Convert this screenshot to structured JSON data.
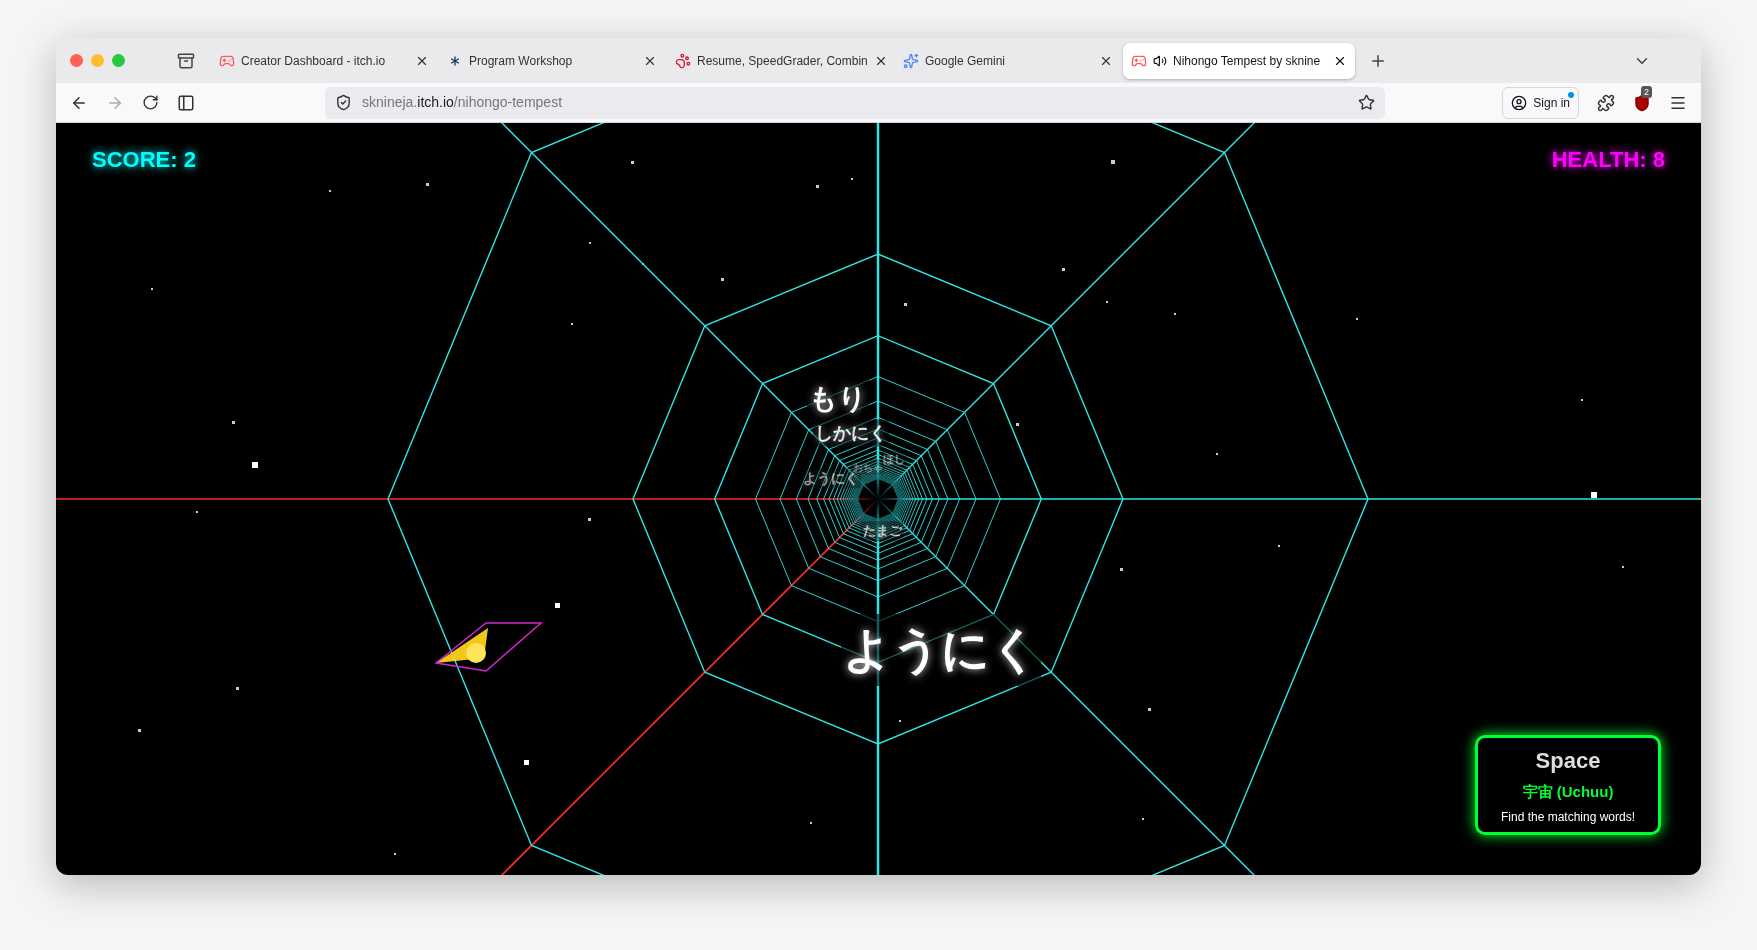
{
  "browser": {
    "tabs": [
      {
        "title": "Creator Dashboard - itch.io",
        "kind": "itch",
        "selected": false,
        "audio": false
      },
      {
        "title": "Program Workshop",
        "kind": "asterisk",
        "selected": false,
        "audio": false
      },
      {
        "title": "Resume, SpeedGrader, Combin",
        "kind": "paw",
        "selected": false,
        "audio": false
      },
      {
        "title": "Google Gemini",
        "kind": "gemini",
        "selected": false,
        "audio": false
      },
      {
        "title": "Nihongo Tempest by sknine",
        "kind": "itch",
        "selected": true,
        "audio": true
      }
    ],
    "address": {
      "subdomain": "sknineja.",
      "host": "itch.io",
      "path": "/nihongo-tempest"
    },
    "sign_in": "Sign in",
    "extension_badge": "2"
  },
  "game": {
    "score": "SCORE: 2",
    "health": "HEALTH: 8",
    "words": [
      "ようにく",
      "もり",
      "しかにく",
      "ようにく",
      "おちゃ",
      "ほし",
      "たまご"
    ],
    "target": {
      "english": "Space",
      "japanese": "宇宙 (Uchuu)",
      "hint": "Find the matching words!"
    }
  }
}
